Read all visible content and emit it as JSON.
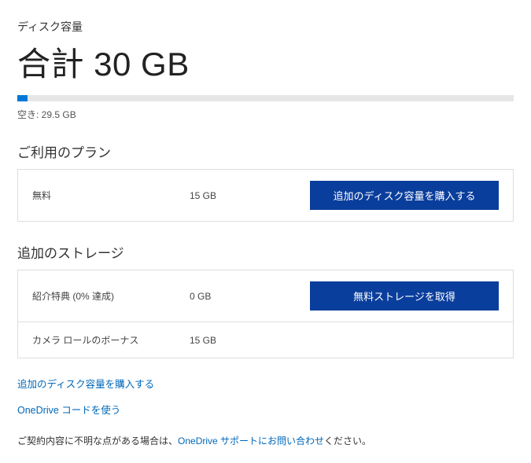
{
  "storage": {
    "disk_label": "ディスク容量",
    "total_text": "合計 30 GB",
    "free_text": "空き: 29.5 GB",
    "used_percent": 2
  },
  "plan_section": {
    "title": "ご利用のプラン",
    "rows": [
      {
        "name": "無料",
        "size": "15 GB",
        "action": "追加のディスク容量を購入する"
      }
    ]
  },
  "additional_section": {
    "title": "追加のストレージ",
    "rows": [
      {
        "name": "紹介特典 (0% 達成)",
        "size": "0 GB",
        "action": "無料ストレージを取得"
      },
      {
        "name": "カメラ ロールのボーナス",
        "size": "15 GB",
        "action": ""
      }
    ]
  },
  "links": {
    "buy_more": "追加のディスク容量を購入する",
    "use_code": "OneDrive コードを使う"
  },
  "support": {
    "prefix": "ご契約内容に不明な点がある場合は、",
    "link": "OneDrive サポートにお問い合わせ",
    "suffix": "ください。"
  }
}
